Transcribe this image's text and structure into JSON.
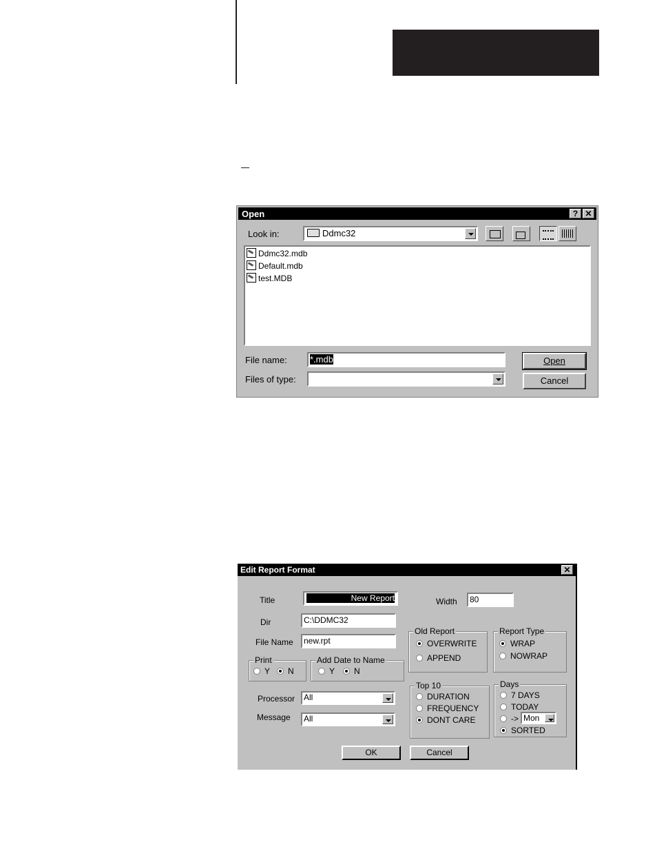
{
  "open_dialog": {
    "title": "Open",
    "help_button": "?",
    "close_button": "✕",
    "look_in_label": "Look in:",
    "look_in_value": "Ddmc32",
    "files": [
      "Ddmc32.mdb",
      "Default.mdb",
      "test.MDB"
    ],
    "file_name_label": "File name:",
    "file_name_value": "*.mdb",
    "files_of_type_label": "Files of type:",
    "files_of_type_value": "",
    "open_button": "Open",
    "cancel_button": "Cancel"
  },
  "edit_dialog": {
    "title": "Edit Report Format",
    "close_button": "✕",
    "title_label": "Title",
    "title_value": "New Report",
    "dir_label": "Dir",
    "dir_value": "C:\\DDMC32",
    "filename_label": "File Name",
    "filename_value": "new.rpt",
    "width_label": "Width",
    "width_value": "80",
    "print_group": {
      "label": "Print",
      "options": [
        "Y",
        "N"
      ],
      "selected": "N"
    },
    "add_date_group": {
      "label": "Add Date to Name",
      "options": [
        "Y",
        "N"
      ],
      "selected": "N"
    },
    "old_report_group": {
      "label": "Old Report",
      "options": [
        "OVERWRITE",
        "APPEND"
      ],
      "selected": "OVERWRITE"
    },
    "report_type_group": {
      "label": "Report Type",
      "options": [
        "WRAP",
        "NOWRAP"
      ],
      "selected": "WRAP"
    },
    "top10_group": {
      "label": "Top 10",
      "options": [
        "DURATION",
        "FREQUENCY",
        "DONT CARE"
      ],
      "selected": "DONT CARE"
    },
    "days_group": {
      "label": "Days",
      "options": [
        "7 DAYS",
        "TODAY",
        "->",
        "SORTED"
      ],
      "selected": "SORTED",
      "day_select_value": "Mon"
    },
    "processor_label": "Processor",
    "processor_value": "All",
    "message_label": "Message",
    "message_value": "All",
    "ok_button": "OK",
    "cancel_button": "Cancel"
  }
}
